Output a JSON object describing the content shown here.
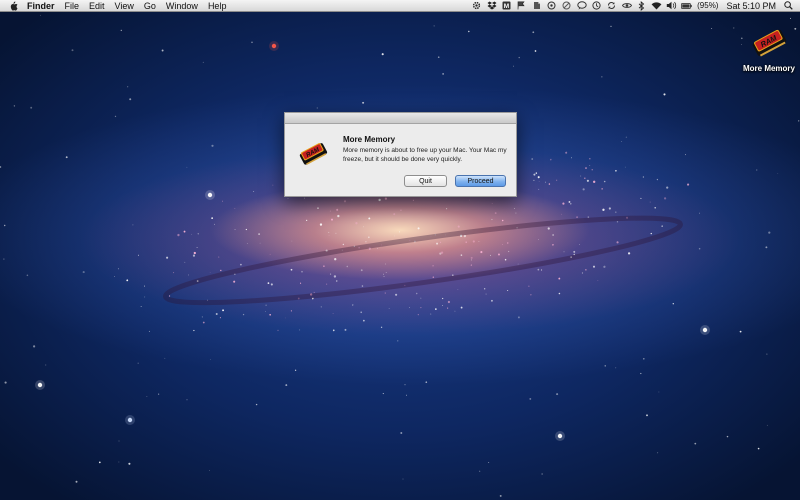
{
  "menubar": {
    "app_name": "Finder",
    "menus": [
      "File",
      "Edit",
      "View",
      "Go",
      "Window",
      "Help"
    ],
    "battery_percent": "(95%)",
    "clock": "Sat 5:10 PM",
    "status_icons": [
      "gear-icon",
      "dropbox-icon",
      "m-icon",
      "flag-icon",
      "evernote-icon",
      "magnifier-icon",
      "block-icon",
      "bubble-icon",
      "timemachine-icon",
      "sync-icon",
      "eye-icon",
      "bluetooth-icon",
      "wifi-icon",
      "volume-icon",
      "battery-icon",
      "spotlight-icon"
    ]
  },
  "desktop": {
    "icon_label": "More Memory",
    "icon_name": "ram-chip-icon"
  },
  "dialog": {
    "title": "More Memory",
    "message": "More memory is about to free up your Mac. Your Mac my freeze, but it should be done very quickly.",
    "quit_label": "Quit",
    "proceed_label": "Proceed"
  },
  "colors": {
    "accent_button": "#7fb2ee",
    "desktop_bg": "#0e2761",
    "galaxy_core": "#ffe1be"
  }
}
